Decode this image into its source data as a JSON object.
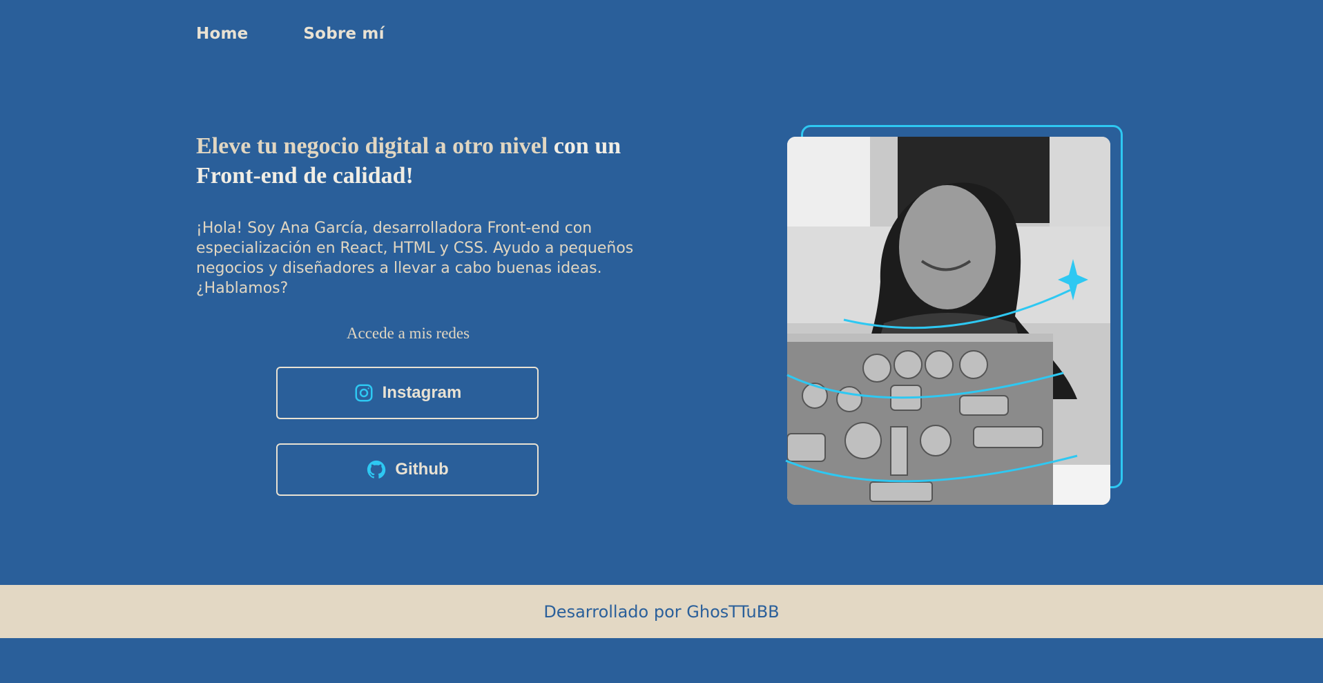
{
  "nav": {
    "items": [
      {
        "label": "Home"
      },
      {
        "label": "Sobre mí"
      }
    ]
  },
  "hero": {
    "title_highlight": "Eleve tu negocio digital a otro nivel",
    "title_rest": " con un Front-end de calidad!",
    "description": "¡Hola! Soy Ana García, desarrolladora Front-end con especialización en React, HTML y CSS. Ayudo a pequeños negocios y diseñadores a llevar a cabo buenas ideas. ¿Hablamos?",
    "social_heading": "Accede a mis redes",
    "buttons": [
      {
        "label": "Instagram",
        "icon": "instagram-icon"
      },
      {
        "label": "Github",
        "icon": "github-icon"
      }
    ]
  },
  "photo": {
    "icon": "profile-photo"
  },
  "footer": {
    "text": "Desarrollado por GhosTTuBB"
  },
  "colors": {
    "background": "#2a5f9a",
    "accent": "#2ec8f2",
    "text_beige": "#e1d6c1",
    "footer_bg": "#e3d8c4"
  }
}
